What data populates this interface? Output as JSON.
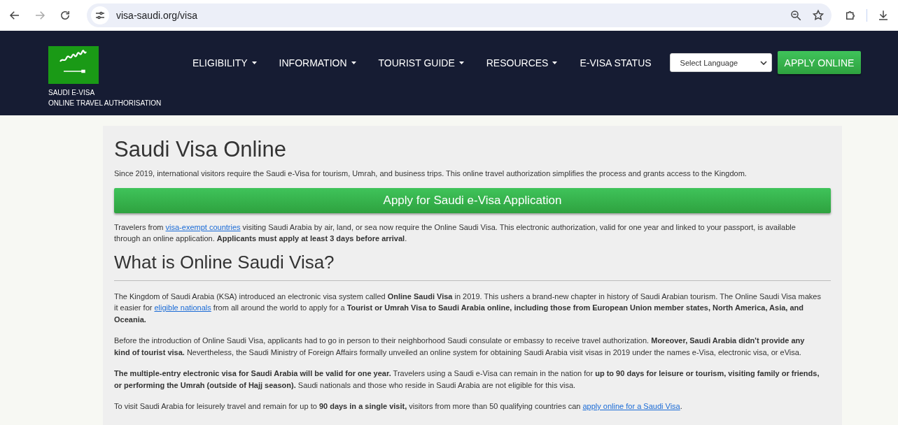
{
  "browser": {
    "url": "visa-saudi.org/visa"
  },
  "header": {
    "brand_lines": [
      "SAUDI E-VISA",
      "ONLINE TRAVEL AUTHORISATION"
    ],
    "nav": [
      {
        "label": "ELIGIBILITY",
        "dropdown": true
      },
      {
        "label": "INFORMATION",
        "dropdown": true
      },
      {
        "label": "TOURIST GUIDE",
        "dropdown": true
      },
      {
        "label": "RESOURCES",
        "dropdown": true
      },
      {
        "label": "E-VISA STATUS",
        "dropdown": false
      }
    ],
    "language_select": "Select Language",
    "apply_button": "APPLY ONLINE"
  },
  "content": {
    "title": "Saudi Visa Online",
    "intro": "Since 2019, international visitors require the Saudi e-Visa for tourism, Umrah, and business trips. This online travel authorization simplifies the process and grants access to the Kingdom.",
    "cta_button": "Apply for Saudi e-Visa Application",
    "notice": [
      {
        "kind": "text",
        "text": "Travelers from "
      },
      {
        "kind": "link",
        "text": "visa-exempt countries"
      },
      {
        "kind": "text",
        "text": " visiting Saudi Arabia by air, land, or sea now require the Online Saudi Visa. This electronic authorization, valid for one year and linked to your passport, is available through an online application. **Applicants must apply at least 3 days before arrival**."
      }
    ],
    "heading": "What is Online Saudi Visa?",
    "paragraphs": [
      [
        {
          "kind": "text",
          "text": "The Kingdom of Saudi Arabia (KSA) introduced an electronic visa system called **Online Saudi Visa** in 2019. This ushers a brand-new chapter in history of Saudi Arabian tourism. The Online Saudi Visa makes it easier for "
        },
        {
          "kind": "link",
          "text": "eligible nationals"
        },
        {
          "kind": "text",
          "text": " from all around the world to apply for a **Tourist or Umrah Visa to Saudi Arabia online, including those from European Union member states, North America, Asia, and Oceania.**"
        }
      ],
      [
        {
          "kind": "text",
          "text": "Before the introduction of Online Saudi Visa, applicants had to go in person to their neighborhood Saudi consulate or embassy to receive travel authorization. **Moreover, Saudi Arabia didn't provide any kind of tourist visa.** Nevertheless, the Saudi Ministry of Foreign Affairs formally unveiled an online system for obtaining Saudi Arabia visit visas in 2019 under the names e-Visa, electronic visa, or eVisa."
        }
      ],
      [
        {
          "kind": "text",
          "text": "**The multiple-entry electronic visa for Saudi Arabia will be valid for one year.** Travelers using a Saudi e-Visa can remain in the nation for **up to 90 days for leisure or tourism, visiting family or friends, or performing the Umrah (outside of Hajj season).** Saudi nationals and those who reside in Saudi Arabia are not eligible for this visa."
        }
      ],
      [
        {
          "kind": "text",
          "text": "To visit Saudi Arabia for leisurely travel and remain for up to **90 days in a single visit,** visitors from more than 50 qualifying countries can "
        },
        {
          "kind": "link",
          "text": "apply online for a Saudi Visa"
        },
        {
          "kind": "text",
          "text": "."
        }
      ]
    ]
  }
}
